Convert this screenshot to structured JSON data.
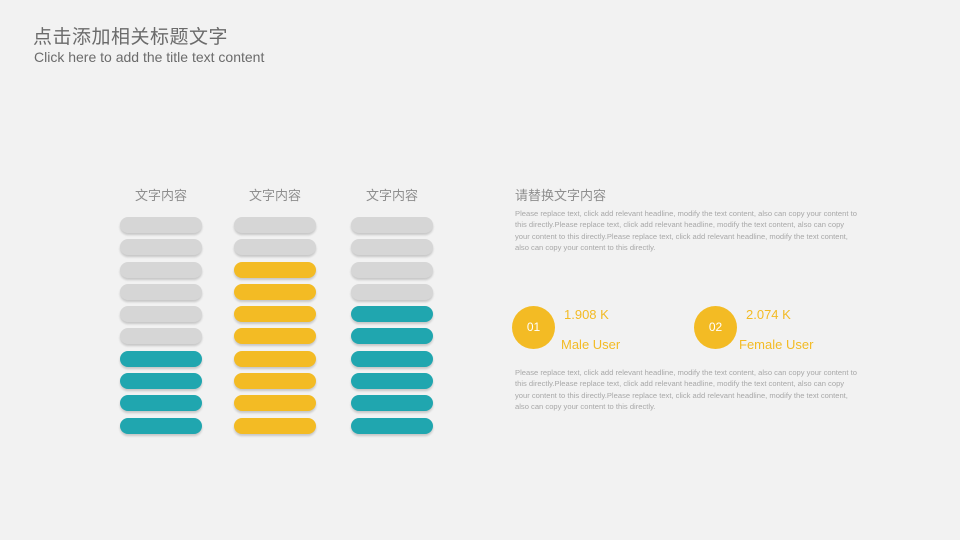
{
  "header": {
    "title_cn": "点击添加相关标题文字",
    "title_en": "Click here to add the title text content"
  },
  "columns": [
    {
      "label": "文字内容",
      "pills": [
        "off",
        "off",
        "off",
        "off",
        "off",
        "off",
        "teal",
        "teal",
        "teal",
        "teal"
      ]
    },
    {
      "label": "文字内容",
      "pills": [
        "off",
        "off",
        "on",
        "on",
        "on",
        "on",
        "on",
        "on",
        "on",
        "on"
      ]
    },
    {
      "label": "文字内容",
      "pills": [
        "off",
        "off",
        "off",
        "off",
        "teal",
        "teal",
        "teal",
        "teal",
        "teal",
        "teal"
      ]
    }
  ],
  "side": {
    "title": "请替换文字内容",
    "paragraph_top": "Please replace text, click add relevant headline, modify the text content, also can copy your content to this directly.Please replace text, click add relevant headline, modify the text content, also can copy your content to this directly.Please replace text, click add relevant headline, modify the text content, also can copy your content to this directly.",
    "paragraph_bottom": "Please replace text, click add relevant headline, modify the text content, also can copy your content to this directly.Please replace text, click add relevant headline, modify the text content, also can copy your content to this directly.Please replace text, click add relevant headline, modify the text content, also can copy your content to this directly.",
    "stats": [
      {
        "num": "01",
        "value": "1.908 K",
        "label": "Male User"
      },
      {
        "num": "02",
        "value": "2.074 K",
        "label": "Female User"
      }
    ]
  },
  "colors": {
    "background": "#f2f2f2",
    "pill_off": "#d6d6d6",
    "accent_yellow": "#f3bb24",
    "accent_teal": "#20a6af",
    "title_text": "#6b6b6b"
  }
}
